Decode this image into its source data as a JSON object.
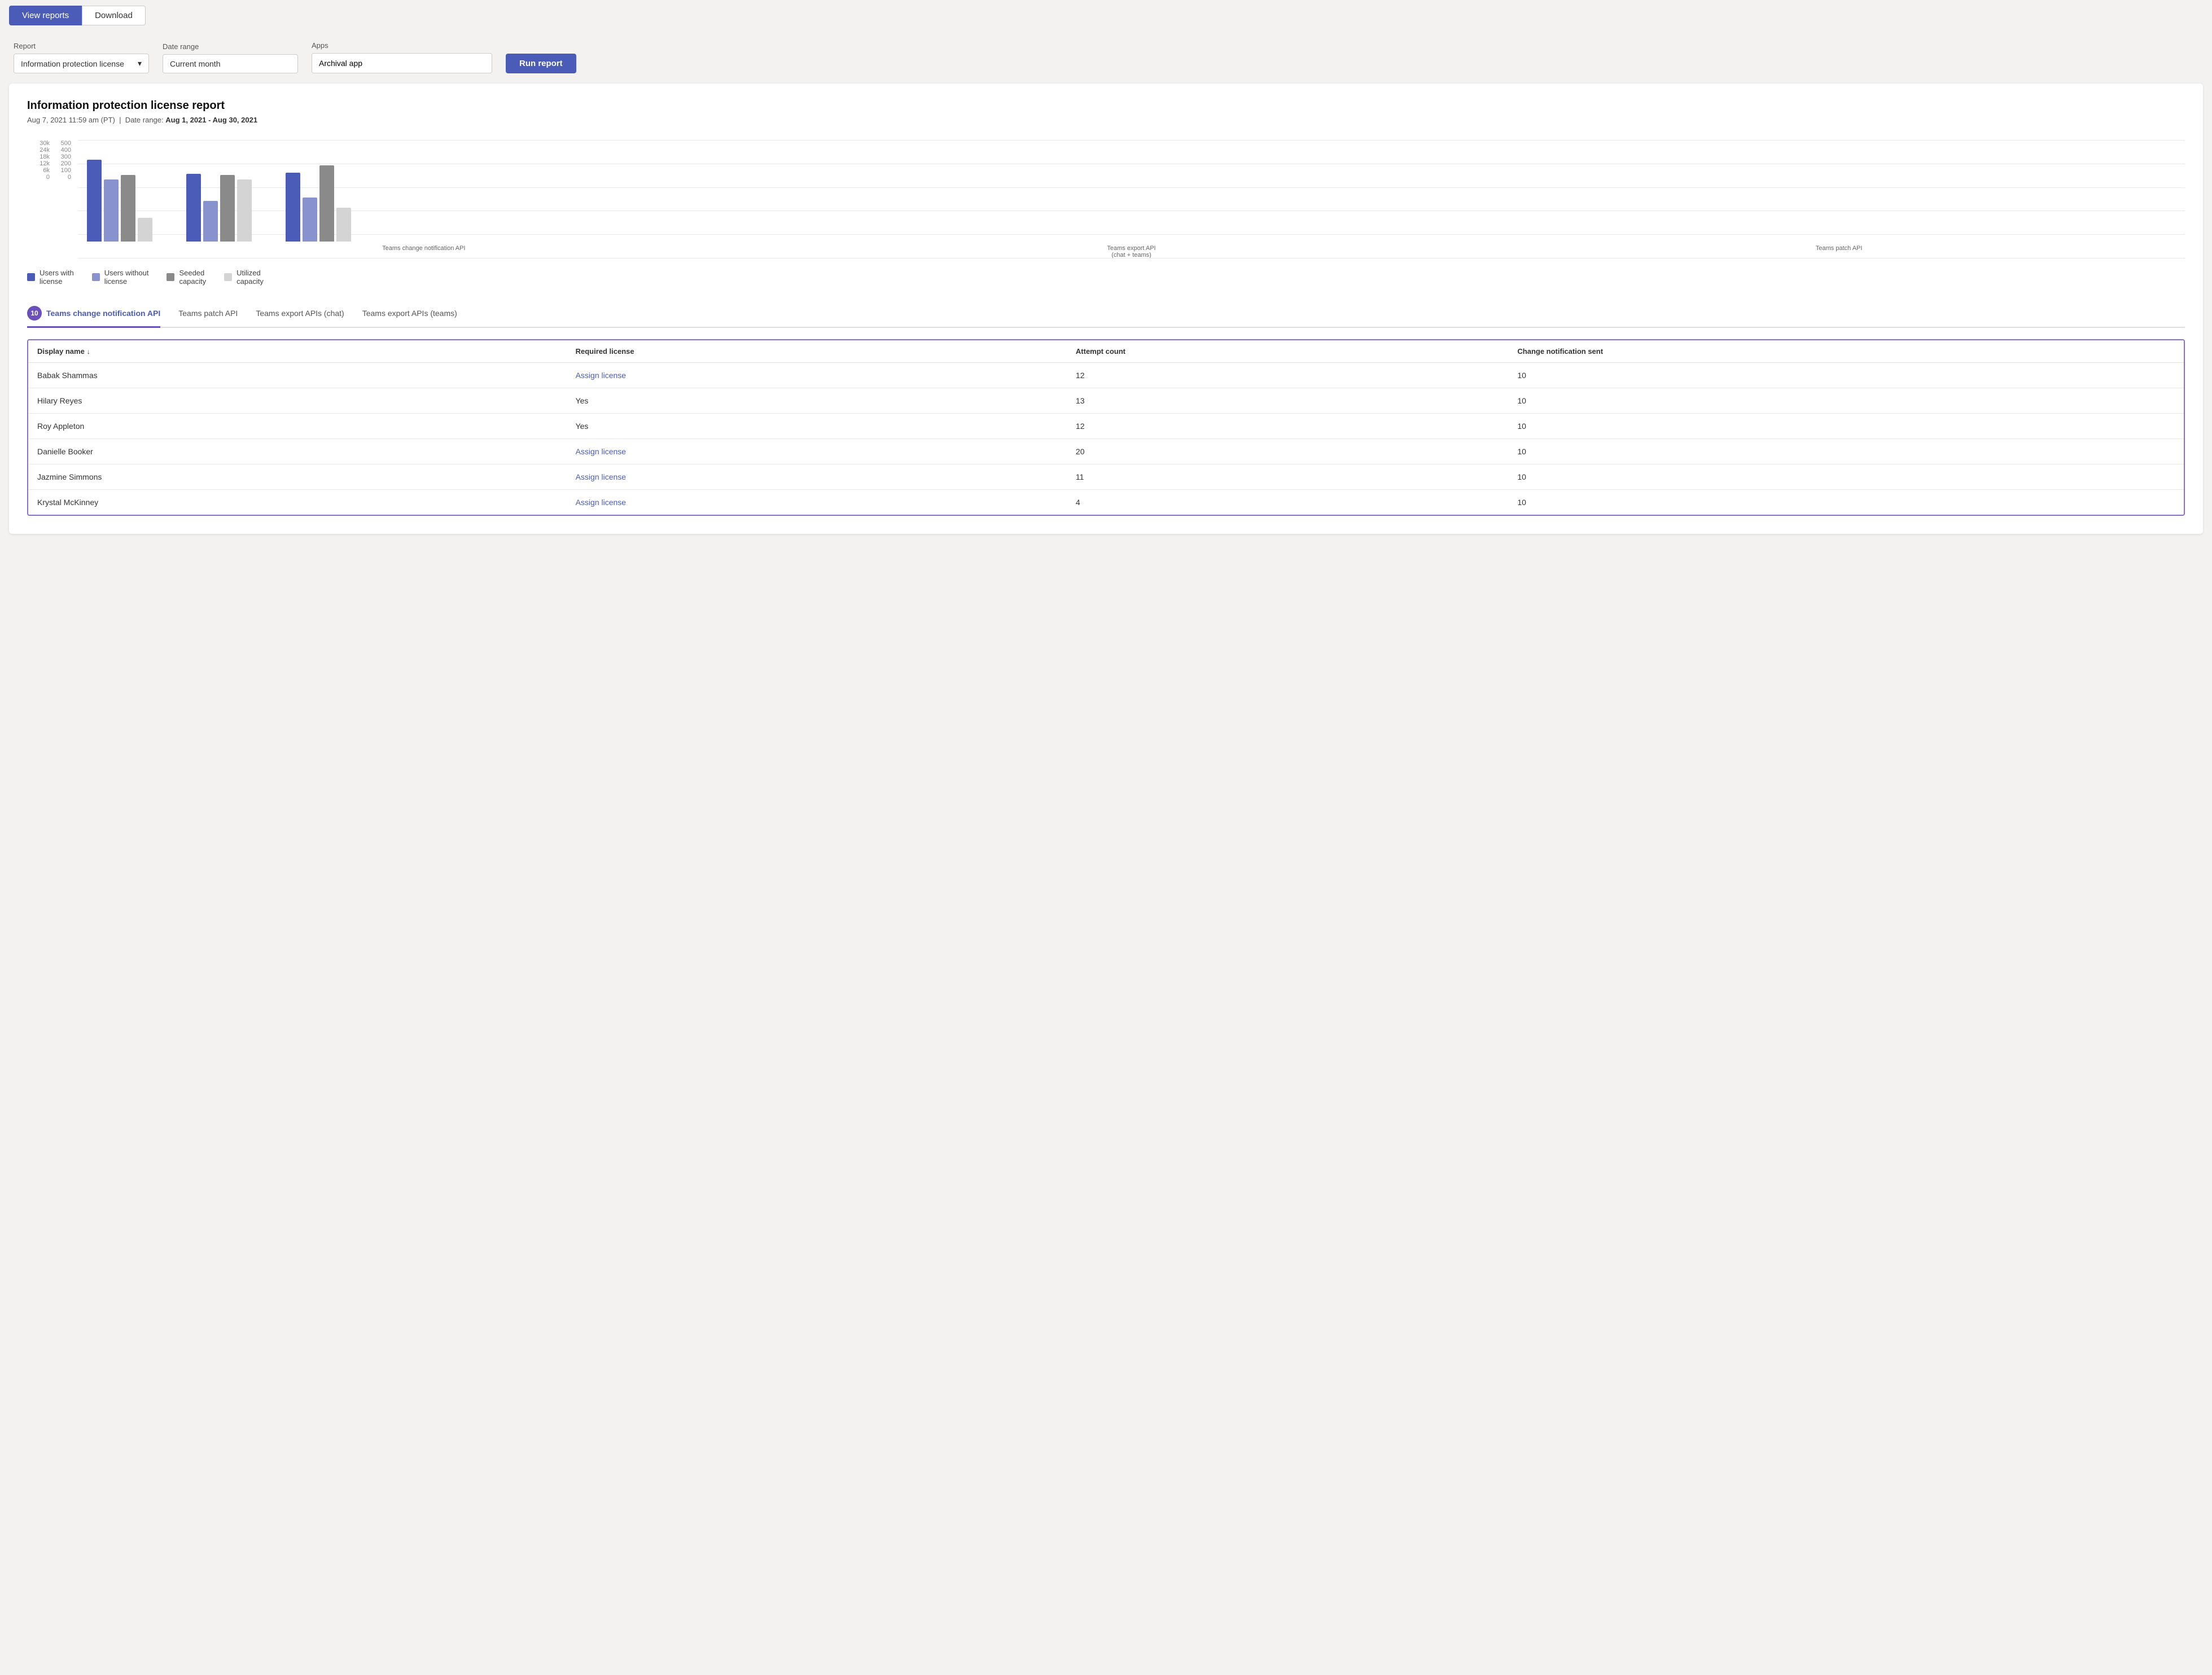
{
  "toolbar": {
    "view_reports_label": "View reports",
    "download_label": "Download"
  },
  "filters": {
    "report_label": "Report",
    "report_value": "Information protection license",
    "date_range_label": "Date range",
    "date_range_value": "Current month",
    "apps_label": "Apps",
    "apps_value": "Archival app",
    "run_report_label": "Run report"
  },
  "report": {
    "title": "Information protection license report",
    "timestamp": "Aug 7, 2021 11:59 am (PT)",
    "date_range_label": "Date range:",
    "date_range_value": "Aug 1, 2021 - Aug 30, 2021"
  },
  "chart": {
    "y_axis_left": [
      "30k",
      "24k",
      "18k",
      "12k",
      "6k",
      "0"
    ],
    "y_axis_right": [
      "500",
      "400",
      "300",
      "200",
      "100",
      "0"
    ],
    "groups": [
      {
        "label": "Teams change notification API",
        "bars": [
          {
            "type": "blue-dark",
            "height": 145
          },
          {
            "type": "blue-medium",
            "height": 110
          },
          {
            "type": "gray-dark",
            "height": 118
          },
          {
            "type": "gray-light",
            "height": 42
          }
        ]
      },
      {
        "label": "Teams export API\n(chat + teams)",
        "bars": [
          {
            "type": "blue-dark",
            "height": 120
          },
          {
            "type": "blue-medium",
            "height": 72
          },
          {
            "type": "gray-dark",
            "height": 118
          },
          {
            "type": "gray-light",
            "height": 110
          }
        ]
      },
      {
        "label": "Teams patch API",
        "bars": [
          {
            "type": "blue-dark",
            "height": 122
          },
          {
            "type": "blue-medium",
            "height": 78
          },
          {
            "type": "gray-dark",
            "height": 135
          },
          {
            "type": "gray-light",
            "height": 60
          }
        ]
      }
    ],
    "legend": [
      {
        "color": "#4b5cb8",
        "label": "Users with\nlicense"
      },
      {
        "color": "#8892cc",
        "label": "Users without\nlicense"
      },
      {
        "color": "#8a8a8a",
        "label": "Seeded\ncapacity"
      },
      {
        "color": "#d4d4d4",
        "label": "Utilized\ncapacity"
      }
    ]
  },
  "tabs": [
    {
      "label": "Teams change notification API",
      "active": true,
      "badge": "10"
    },
    {
      "label": "Teams patch API",
      "active": false,
      "badge": null
    },
    {
      "label": "Teams export APIs (chat)",
      "active": false,
      "badge": null
    },
    {
      "label": "Teams export APIs (teams)",
      "active": false,
      "badge": null
    }
  ],
  "table": {
    "columns": [
      {
        "label": "Display name",
        "sortable": true,
        "sort_icon": "↓"
      },
      {
        "label": "Required license",
        "sortable": false
      },
      {
        "label": "Attempt count",
        "sortable": false
      },
      {
        "label": "Change notification sent",
        "sortable": false
      }
    ],
    "rows": [
      {
        "name": "Babak Shammas",
        "required_license": "Assign license",
        "is_link": true,
        "attempt_count": "12",
        "notification_sent": "10"
      },
      {
        "name": "Hilary Reyes",
        "required_license": "Yes",
        "is_link": false,
        "attempt_count": "13",
        "notification_sent": "10"
      },
      {
        "name": "Roy Appleton",
        "required_license": "Yes",
        "is_link": false,
        "attempt_count": "12",
        "notification_sent": "10"
      },
      {
        "name": "Danielle Booker",
        "required_license": "Assign license",
        "is_link": true,
        "attempt_count": "20",
        "notification_sent": "10"
      },
      {
        "name": "Jazmine Simmons",
        "required_license": "Assign license",
        "is_link": true,
        "attempt_count": "11",
        "notification_sent": "10"
      },
      {
        "name": "Krystal McKinney",
        "required_license": "Assign license",
        "is_link": true,
        "attempt_count": "4",
        "notification_sent": "10"
      }
    ]
  }
}
